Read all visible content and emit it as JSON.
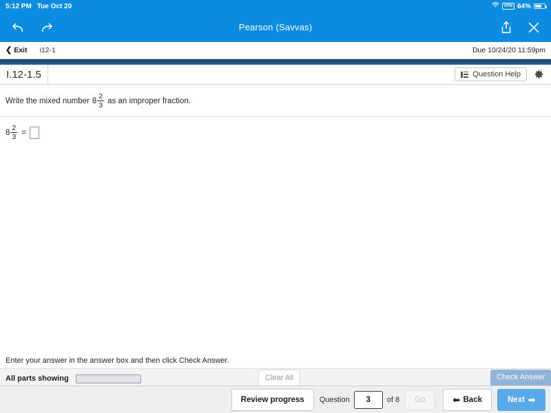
{
  "status_bar": {
    "time": "5:12 PM",
    "date": "Tue Oct 20",
    "wifi_icon": "wifi-icon",
    "vpn_label": "VPN",
    "battery_percent": "64%",
    "battery_icon": "battery-icon"
  },
  "browser_nav": {
    "back_icon": "back-arrow-icon",
    "forward_icon": "forward-arrow-icon",
    "title": "Pearson (Savvas)",
    "share_icon": "share-icon",
    "close_icon": "close-icon",
    "bar_color": "#0c8ce0"
  },
  "sub_header": {
    "exit_label": "Exit",
    "exit_chevron_icon": "chevron-left-icon",
    "assignment_id": "i12-1",
    "due_text": "Due 10/24/20 11:59pm"
  },
  "exercise_header": {
    "title": "I.12-1.5",
    "question_help_label": "Question Help",
    "question_help_icon": "list-icon",
    "settings_icon": "gear-icon",
    "rule_color": "#1f4f7c"
  },
  "question": {
    "prompt_before": "Write the mixed number",
    "prompt_after": "as an improper fraction.",
    "mixed_whole": "8",
    "mixed_numerator": "2",
    "mixed_denominator": "3",
    "answer_whole": "8",
    "answer_numerator": "2",
    "answer_denominator": "3",
    "equals": "=",
    "answer_value": "",
    "answer_placeholder": ""
  },
  "instruction": {
    "text": "Enter your answer in the answer box and then click Check Answer."
  },
  "parts_row": {
    "parts_label": "All parts showing",
    "progress_percent": 100,
    "progress_color": "#4a7fb5",
    "clear_all_label": "Clear All",
    "check_answer_label": "Check Answer",
    "check_answer_color": "#8fb4d8"
  },
  "bottom_bar": {
    "review_progress_label": "Review progress",
    "question_word": "Question",
    "question_number": "3",
    "of_label": "of 8",
    "go_label": "Go",
    "back_label": "Back",
    "back_arrow_icon": "arrow-left-icon",
    "next_label": "Next",
    "next_arrow_icon": "arrow-right-icon",
    "next_color": "#5aa9e8"
  }
}
